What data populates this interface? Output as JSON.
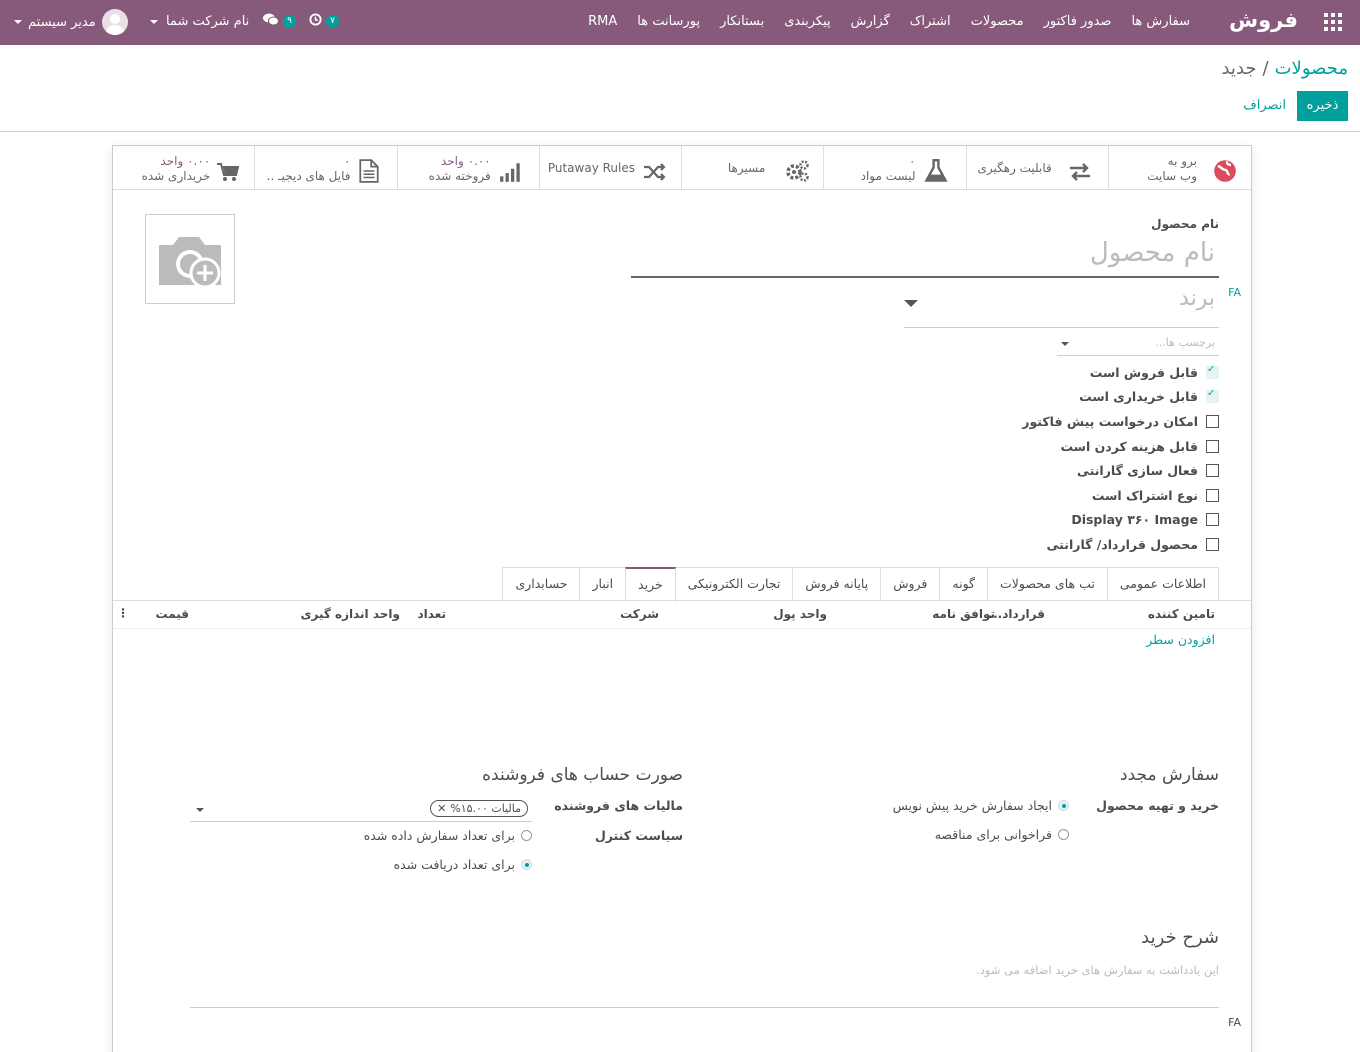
{
  "navbar": {
    "brand": "فروش",
    "menu": [
      "سفارش ها",
      "صدور فاکتور",
      "محصولات",
      "اشتراک",
      "گزارش",
      "پیکربندی",
      "بستانکار",
      "پورسانت ها",
      "RMA"
    ],
    "activity_count": "۷",
    "messages_count": "۹",
    "company": "نام شرکت شما",
    "user": "مدیر سیستم",
    "bar_color": "#875a7b"
  },
  "breadcrumb": {
    "parent": "محصولات",
    "separator": "/",
    "current": "جدید"
  },
  "actions": {
    "save": "ذخیره",
    "discard": "انصراف"
  },
  "smart_buttons": [
    {
      "line1": "برو به",
      "line2": "وب سایت",
      "icon": "globe-icon"
    },
    {
      "line1": "قابلیت رهگیری",
      "line2": "",
      "icon": "arrows-exchange-icon"
    },
    {
      "line1": "۰",
      "line2": "لیست مواد",
      "icon": "flask-icon"
    },
    {
      "line1": "مسیرها",
      "line2": "",
      "icon": "cogs-icon"
    },
    {
      "line1": "Putaway Rules",
      "line2": "",
      "icon": "random-icon"
    },
    {
      "line1": "۰.۰۰ واحد",
      "line2": "فروخته شده",
      "icon": "bar-chart-icon"
    },
    {
      "line1": "۰",
      "line2": "فایل های دیجیـ ..",
      "icon": "file-icon"
    },
    {
      "line1": "۰.۰۰ واحد",
      "line2": "خریداری شده",
      "icon": "cart-icon"
    }
  ],
  "product": {
    "name_label": "نام محصول",
    "name_placeholder": "نام محصول",
    "lang": "FA",
    "brand_placeholder": "برند",
    "tags_placeholder": "برچسب ها..."
  },
  "checkboxes": [
    {
      "label": "قابل فروش است",
      "checked": true
    },
    {
      "label": "قابل خریداری است",
      "checked": true
    },
    {
      "label": "امکان درخواست پیش فاکتور",
      "checked": false
    },
    {
      "label": "قابل هزینه کردن است",
      "checked": false
    },
    {
      "label": "فعال سازی گارانتی",
      "checked": false
    },
    {
      "label": "نوع اشتراک است",
      "checked": false
    },
    {
      "label": "Display ۳۶۰ Image",
      "checked": false
    },
    {
      "label": "محصول قرارداد/ گارانتی",
      "checked": false
    }
  ],
  "tabs": [
    {
      "label": "اطلاعات عمومی",
      "active": false
    },
    {
      "label": "تب های محصولات",
      "active": false
    },
    {
      "label": "گونه",
      "active": false
    },
    {
      "label": "فروش",
      "active": false
    },
    {
      "label": "پایانه فروش",
      "active": false
    },
    {
      "label": "تجارت الکترونیکی",
      "active": false
    },
    {
      "label": "خرید",
      "active": true
    },
    {
      "label": "انبار",
      "active": false
    },
    {
      "label": "حسابداری",
      "active": false
    }
  ],
  "vendor_table": {
    "columns": [
      "تامین کننده",
      "قرارداد...",
      "توافق نامه",
      "واحد پول",
      "شرکت",
      "تعداد",
      "واحد اندازه گیری",
      "قیمت"
    ],
    "add_line": "افزودن سطر"
  },
  "reordering": {
    "title": "سفارش مجدد",
    "field_label": "خرید و تهیه محصول",
    "options": [
      {
        "label": "ایجاد سفارش خرید پیش نویس",
        "selected": true
      },
      {
        "label": "فراخوانی برای مناقصه",
        "selected": false
      }
    ]
  },
  "vendor_bills": {
    "title": "صورت حساب های فروشنده",
    "tax_label": "مالیات های فروشنده",
    "tax_tag": "مالیات ۱۵.۰۰%",
    "control_label": "سیاست کنترل",
    "control_options": [
      {
        "label": "برای تعداد سفارش داده شده",
        "selected": false
      },
      {
        "label": "برای تعداد دریافت شده",
        "selected": true
      }
    ]
  },
  "purchase_description": {
    "title": "شرح خرید",
    "placeholder": "این یادداشت به سفارش های خرید اضافه می شود.",
    "lang": "FA"
  },
  "colors": {
    "primary": "#875a7b",
    "accent": "#00a09d"
  }
}
